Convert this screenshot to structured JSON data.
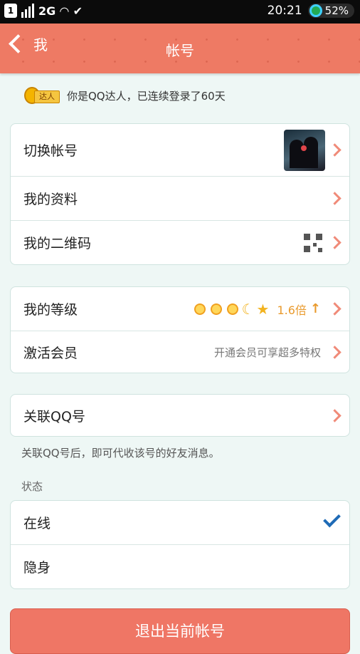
{
  "status_bar": {
    "sim": "1",
    "network": "2G",
    "time": "20:21",
    "battery": "52%"
  },
  "header": {
    "back_label": "我",
    "title": "帐号",
    "color": "#ee7a64"
  },
  "talent": {
    "badge_text": "达人",
    "message": "你是QQ达人，已连续登录了60天"
  },
  "account_group": {
    "switch_account": "切换帐号",
    "my_profile": "我的资料",
    "my_qrcode": "我的二维码"
  },
  "level_group": {
    "my_level": "我的等级",
    "multiplier": "1.6倍",
    "activate_member": "激活会员",
    "member_hint": "开通会员可享超多特权"
  },
  "link_group": {
    "link_qq": "关联QQ号",
    "note": "关联QQ号后，即可代收该号的好友消息。"
  },
  "status_section": {
    "title": "状态",
    "online": "在线",
    "invisible": "隐身",
    "selected": "在线"
  },
  "logout_label": "退出当前帐号"
}
